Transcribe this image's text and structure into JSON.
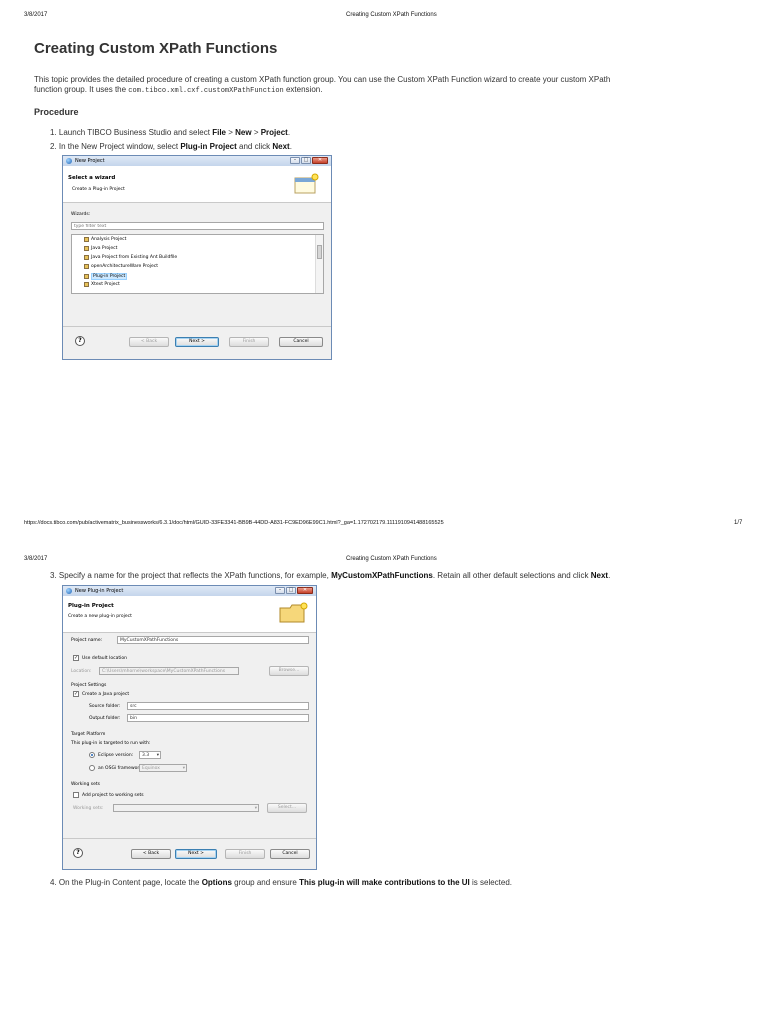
{
  "page1": {
    "header_date": "3/8/2017",
    "header_title": "Creating Custom XPath Functions",
    "title": "Creating Custom XPath Functions",
    "intro_line1": "This topic provides the detailed procedure of creating a custom XPath function group. You can use the Custom XPath Function wizard to create your custom XPath",
    "intro_line2_pre": "function group. It uses the",
    "intro_code": "com.tibco.xml.cxf.customXPathFunction",
    "intro_line2_post": "extension.",
    "procedure_heading": "Procedure",
    "step1": {
      "num": "1.",
      "t1": "Launch TIBCO Business Studio and select",
      "b1": "File",
      "t2": ">",
      "b2": "New",
      "t3": ">",
      "b3": "Project",
      "t4": "."
    },
    "step2": {
      "num": "2.",
      "t1": "In the New Project window, select",
      "b1": "Plug-in Project",
      "t2": "and click",
      "b2": "Next",
      "t3": "."
    },
    "footer_url": "https://docs.tibco.com/pub/activematrix_businessworks/6.3.1/doc/html/GUID-33FE3341-BB9B-44DD-A831-FC9ED96E99C1.html?_ga=1.172702179.1111910941488165525",
    "footer_page": "1/7"
  },
  "dialog1": {
    "title": "New Project",
    "banner_title": "Select a wizard",
    "banner_sub": "Create a Plug-in Project",
    "wizards_label": "Wizards:",
    "filter_placeholder": "type filter text",
    "items": [
      "Analysis Project",
      "Java Project",
      "Java Project from Existing Ant Buildfile",
      "openArchitectureWare Project",
      "Plug-in Project",
      "Xtext Project"
    ],
    "selected_item": "Plug-in Project",
    "help": "?",
    "back": "< Back",
    "next": "Next >",
    "finish": "Finish",
    "cancel": "Cancel"
  },
  "page2": {
    "header_date": "3/8/2017",
    "header_title": "Creating Custom XPath Functions",
    "step3": {
      "num": "3.",
      "t1": "Specify a name for the project that reflects the XPath functions, for example,",
      "b1": "MyCustomXPathFunctions",
      "t2": ". Retain all other default selections and click",
      "b2": "Next",
      "t3": "."
    },
    "step4": {
      "num": "4.",
      "t1": "On the Plug-in Content page, locate the",
      "b1": "Options",
      "t2": "group and ensure",
      "b2": "This plug-in will make contributions to the UI",
      "t3": "is selected."
    }
  },
  "dialog2": {
    "title": "New Plug-in Project",
    "banner_title": "Plug-in Project",
    "banner_sub": "Create a new plug-in project",
    "project_name_label": "Project name:",
    "project_name_value": "MyCustomXPathFunctions",
    "use_default_location": "Use default location",
    "location_label": "Location:",
    "location_value": "C:\\Users\\mhorne\\workspace\\MyCustomXPathFunctions",
    "browse": "Browse...",
    "project_settings": "Project Settings",
    "create_java_project": "Create a Java project",
    "source_folder_label": "Source folder:",
    "source_folder_value": "src",
    "output_folder_label": "Output folder:",
    "output_folder_value": "bin",
    "target_platform": "Target Platform",
    "targeted_to_run": "This plug-in is targeted to run with:",
    "eclipse_version_label": "Eclipse version:",
    "eclipse_version_value": "3.3",
    "osgi_label": "an OSGi framework:",
    "osgi_value": "Equinox",
    "working_sets": "Working sets",
    "add_to_working_sets": "Add project to working sets",
    "working_sets_label": "Working sets:",
    "select": "Select...",
    "help": "?",
    "back": "< Back",
    "next": "Next >",
    "finish": "Finish",
    "cancel": "Cancel"
  }
}
